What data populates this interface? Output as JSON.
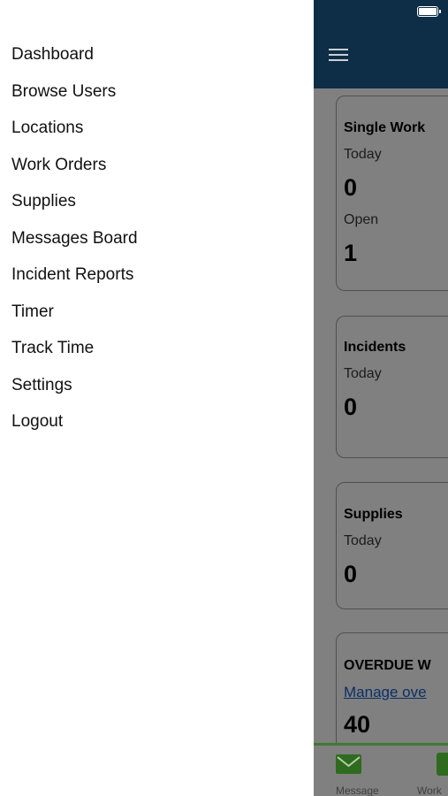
{
  "drawer": {
    "items": [
      {
        "label": "Dashboard"
      },
      {
        "label": "Browse Users"
      },
      {
        "label": "Locations"
      },
      {
        "label": "Work Orders"
      },
      {
        "label": "Supplies"
      },
      {
        "label": "Messages Board"
      },
      {
        "label": "Incident Reports"
      },
      {
        "label": "Timer"
      },
      {
        "label": "Track Time"
      },
      {
        "label": "Settings"
      },
      {
        "label": "Logout"
      }
    ]
  },
  "header": {
    "menu_icon": "hamburger-menu-icon",
    "status_icon": "battery-icon",
    "color": "#0e2d46"
  },
  "cards": {
    "single_work": {
      "title": "Single Work",
      "today_label": "Today",
      "today_value": "0",
      "open_label": "Open",
      "open_value": "1"
    },
    "incidents": {
      "title": "Incidents",
      "today_label": "Today",
      "today_value": "0"
    },
    "supplies": {
      "title": "Supplies",
      "today_label": "Today",
      "today_value": "0"
    },
    "overdue": {
      "title": "OVERDUE W",
      "link": "Manage ove",
      "value": "40"
    }
  },
  "tabbar": {
    "tabs": [
      {
        "label": "Message",
        "icon": "envelope-icon"
      },
      {
        "label": "Work",
        "icon": "clipboard-icon"
      }
    ],
    "accent": "#3f7a2e"
  }
}
